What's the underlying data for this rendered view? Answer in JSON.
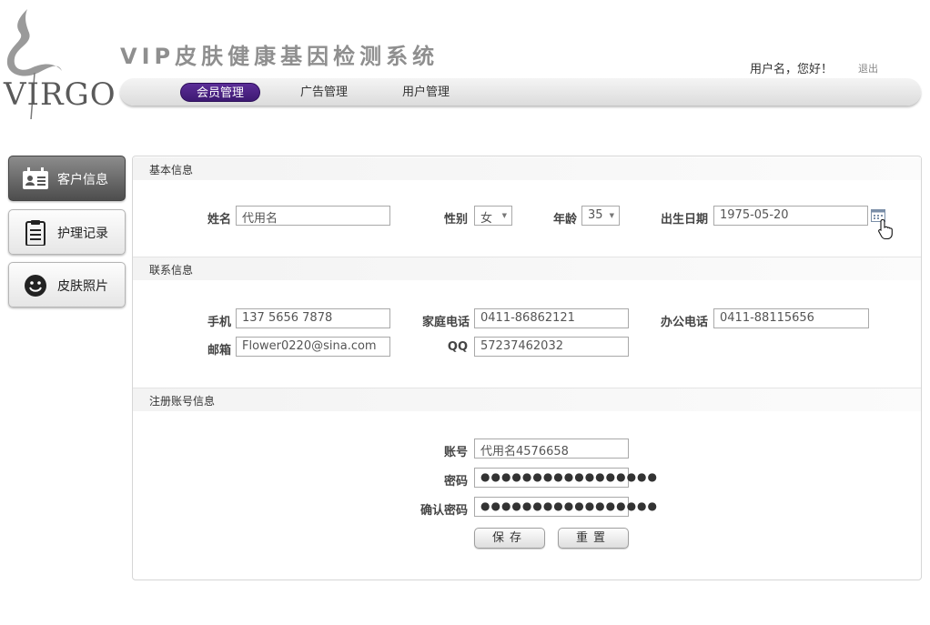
{
  "header": {
    "logo_text": "VIRGO",
    "system_title": "VIP皮肤健康基因检测系统",
    "greeting": "用户名，您好！",
    "logout": "退出"
  },
  "nav": {
    "items": [
      {
        "label": "会员管理",
        "active": true
      },
      {
        "label": "广告管理",
        "active": false
      },
      {
        "label": "用户管理",
        "active": false
      }
    ]
  },
  "sidebar": {
    "items": [
      {
        "label": "客户信息",
        "icon": "contact-card-icon",
        "active": true
      },
      {
        "label": "护理记录",
        "icon": "clipboard-icon",
        "active": false
      },
      {
        "label": "皮肤照片",
        "icon": "smiley-icon",
        "active": false
      }
    ]
  },
  "basic": {
    "title": "基本信息",
    "name_label": "姓名",
    "name_value": "代用名",
    "gender_label": "性别",
    "gender_value": "女",
    "age_label": "年龄",
    "age_value": "35",
    "birth_label": "出生日期",
    "birth_value": "1975-05-20"
  },
  "contact": {
    "title": "联系信息",
    "mobile_label": "手机",
    "mobile_value": "137 5656 7878",
    "home_label": "家庭电话",
    "home_value": "0411-86862121",
    "office_label": "办公电话",
    "office_value": "0411-88115656",
    "email_label": "邮箱",
    "email_value": "Flower0220@sina.com",
    "qq_label": "QQ",
    "qq_value": "57237462032"
  },
  "account": {
    "title": "注册账号信息",
    "account_label": "账号",
    "account_value": "代用名4576658",
    "password_label": "密码",
    "password_value": "●●●●●●●●●●●●●●●●●",
    "confirm_label": "确认密码",
    "confirm_value": "●●●●●●●●●●●●●●●●●",
    "save": "保存",
    "reset": "重置"
  },
  "colors": {
    "nav_active": "#4a2283",
    "sidebar_active": "#5e5e5e"
  }
}
